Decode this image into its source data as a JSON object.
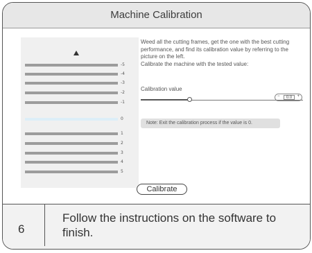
{
  "window": {
    "title": "Machine Calibration"
  },
  "preview": {
    "labels": [
      "-5",
      "-4",
      "-3",
      "-2",
      "-1",
      "0",
      "1",
      "2",
      "3",
      "4",
      "5"
    ]
  },
  "instructions": {
    "line1": "Weed all the cutting frames, get the one with the best cutting performance, and find its calibration value by referring to the picture on the left.",
    "line2": "Calibrate the machine with the tested value:"
  },
  "calibration": {
    "label": "Calibration value",
    "minus": "−",
    "value": "0.0",
    "plus": "+"
  },
  "note": "Note: Exit the calibration process if the value is 0.",
  "calibrate_button": "Calibrate",
  "step": {
    "number": "6",
    "text": "Follow the instructions on the software to finish."
  }
}
